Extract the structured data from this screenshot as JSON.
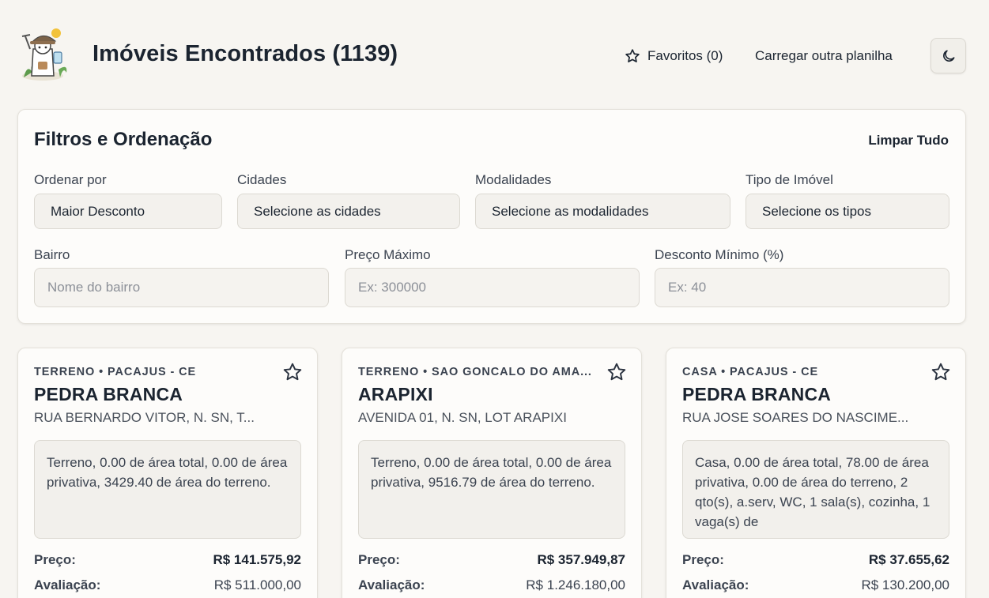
{
  "header": {
    "title": "Imóveis Encontrados (1139)",
    "favorites_label": "Favoritos (0)",
    "load_label": "Carregar outra planilha"
  },
  "filters": {
    "title": "Filtros e Ordenação",
    "clear_label": "Limpar Tudo",
    "sort_label": "Ordenar por",
    "sort_value": "Maior Desconto",
    "cities_label": "Cidades",
    "cities_value": "Selecione as cidades",
    "modalities_label": "Modalidades",
    "modalities_value": "Selecione as modalidades",
    "type_label": "Tipo de Imóvel",
    "type_value": "Selecione os tipos",
    "bairro_label": "Bairro",
    "bairro_placeholder": "Nome do bairro",
    "price_label": "Preço Máximo",
    "price_placeholder": "Ex: 300000",
    "discount_label": "Desconto Mínimo (%)",
    "discount_placeholder": "Ex: 40"
  },
  "cards": [
    {
      "meta": "TERRENO • PACAJUS - CE",
      "title": "PEDRA BRANCA",
      "address": "RUA BERNARDO VITOR, N. SN, T...",
      "description": "Terreno, 0.00 de área total, 0.00 de área privativa, 3429.40 de área do terreno.",
      "price_label": "Preço:",
      "price": "R$ 141.575,92",
      "eval_label": "Avaliação:",
      "eval": "R$ 511.000,00"
    },
    {
      "meta": "TERRENO • SAO GONCALO DO AMA...",
      "title": "ARAPIXI",
      "address": "AVENIDA 01, N. SN, LOT ARAPIXI",
      "description": "Terreno, 0.00 de área total, 0.00 de área privativa, 9516.79 de área do terreno.",
      "price_label": "Preço:",
      "price": "R$ 357.949,87",
      "eval_label": "Avaliação:",
      "eval": "R$ 1.246.180,00"
    },
    {
      "meta": "CASA • PACAJUS - CE",
      "title": "PEDRA BRANCA",
      "address": "RUA JOSE SOARES DO NASCIME...",
      "description": "Casa, 0.00 de área total, 78.00 de área privativa, 0.00 de área do terreno, 2 qto(s), a.serv, WC, 1 sala(s), cozinha, 1 vaga(s) de",
      "price_label": "Preço:",
      "price": "R$ 37.655,62",
      "eval_label": "Avaliação:",
      "eval": "R$ 130.200,00"
    }
  ],
  "icons": {
    "logo": "explorer-house-logo",
    "favorites": "star-icon",
    "theme": "moon-icon",
    "card_favorite": "star-outline-icon"
  },
  "colors": {
    "background": "#f7f5f1",
    "panel": "#fdfcfa",
    "text": "#1b2430",
    "field": "#f3f1ed"
  }
}
